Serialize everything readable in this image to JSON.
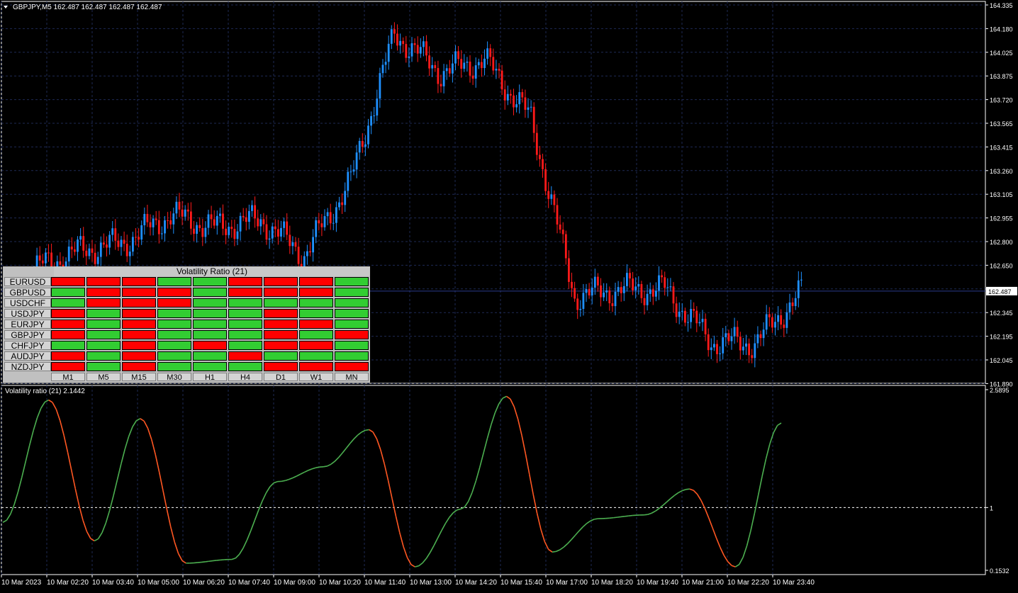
{
  "chart": {
    "title": "GBPJPY,M5  162.487 162.487 162.487 162.487",
    "current_price": "162.487",
    "price_ticks": [
      "164.335",
      "164.180",
      "164.025",
      "163.875",
      "163.720",
      "163.565",
      "163.415",
      "163.260",
      "163.105",
      "162.955",
      "162.800",
      "162.650",
      "162.495",
      "162.345",
      "162.195",
      "162.045",
      "161.890"
    ],
    "time_ticks": [
      "10 Mar 2023",
      "10 Mar 02:20",
      "10 Mar 03:40",
      "10 Mar 05:00",
      "10 Mar 06:20",
      "10 Mar 07:40",
      "10 Mar 09:00",
      "10 Mar 10:20",
      "10 Mar 11:40",
      "10 Mar 13:00",
      "10 Mar 14:20",
      "10 Mar 15:40",
      "10 Mar 17:00",
      "10 Mar 18:20",
      "10 Mar 19:40",
      "10 Mar 21:00",
      "10 Mar 22:20",
      "10 Mar 23:40"
    ],
    "colors": {
      "bull": "#1e90ff",
      "bear": "#ff1a1a",
      "up": "#4caf50",
      "down": "#ff5722",
      "grid": "#1e2a55"
    }
  },
  "indicator": {
    "title": "Volatility ratio (21) 2.1442",
    "ticks": [
      "2.5895",
      "1",
      "0.1532"
    ]
  },
  "panel": {
    "title": "Volatility Ratio (21)",
    "timeframes": [
      "M1",
      "M5",
      "M15",
      "M30",
      "H1",
      "H4",
      "D1",
      "W1",
      "MN"
    ],
    "rows": [
      {
        "symbol": "EURUSD",
        "cells": [
          "r",
          "r",
          "r",
          "g",
          "g",
          "r",
          "r",
          "r",
          "g"
        ]
      },
      {
        "symbol": "GBPUSD",
        "cells": [
          "g",
          "r",
          "r",
          "r",
          "g",
          "r",
          "r",
          "r",
          "g"
        ]
      },
      {
        "symbol": "USDCHF",
        "cells": [
          "g",
          "r",
          "r",
          "r",
          "g",
          "g",
          "g",
          "g",
          "g"
        ]
      },
      {
        "symbol": "USDJPY",
        "cells": [
          "r",
          "g",
          "r",
          "g",
          "g",
          "g",
          "r",
          "g",
          "g"
        ]
      },
      {
        "symbol": "EURJPY",
        "cells": [
          "r",
          "g",
          "r",
          "g",
          "g",
          "g",
          "r",
          "r",
          "g"
        ]
      },
      {
        "symbol": "GBPJPY",
        "cells": [
          "r",
          "g",
          "r",
          "g",
          "g",
          "g",
          "r",
          "g",
          "r"
        ]
      },
      {
        "symbol": "CHFJPY",
        "cells": [
          "g",
          "g",
          "r",
          "g",
          "r",
          "g",
          "r",
          "r",
          "g"
        ]
      },
      {
        "symbol": "AUDJPY",
        "cells": [
          "r",
          "g",
          "r",
          "g",
          "g",
          "r",
          "g",
          "g",
          "g"
        ]
      },
      {
        "symbol": "NZDJPY",
        "cells": [
          "r",
          "g",
          "r",
          "g",
          "g",
          "g",
          "r",
          "r",
          "r"
        ]
      }
    ]
  },
  "chart_data": {
    "type": "line",
    "title": "Volatility ratio (21) 2.1442",
    "x": [
      "10 Mar 2023",
      "10 Mar 02:20",
      "10 Mar 03:40",
      "10 Mar 05:00",
      "10 Mar 06:20",
      "10 Mar 07:40",
      "10 Mar 09:00",
      "10 Mar 10:20",
      "10 Mar 11:40",
      "10 Mar 13:00",
      "10 Mar 14:20",
      "10 Mar 15:40",
      "10 Mar 17:00",
      "10 Mar 18:20",
      "10 Mar 19:40",
      "10 Mar 21:00",
      "10 Mar 22:20",
      "10 Mar 23:40"
    ],
    "series": [
      {
        "name": "GBPJPY,M5",
        "values": [
          162.63,
          162.75,
          162.8,
          162.98,
          162.9,
          162.95,
          162.72,
          163.2,
          164.15,
          163.9,
          163.98,
          163.6,
          162.45,
          162.5,
          162.5,
          162.16,
          162.15,
          162.48
        ]
      },
      {
        "name": "Volatility ratio (21)",
        "values": [
          0.8,
          2.45,
          0.55,
          2.2,
          0.25,
          0.3,
          1.35,
          1.55,
          2.05,
          0.2,
          0.98,
          2.5,
          0.4,
          0.85,
          0.9,
          1.25,
          0.2,
          2.14
        ]
      }
    ],
    "ylim": [
      161.89,
      164.335
    ]
  }
}
